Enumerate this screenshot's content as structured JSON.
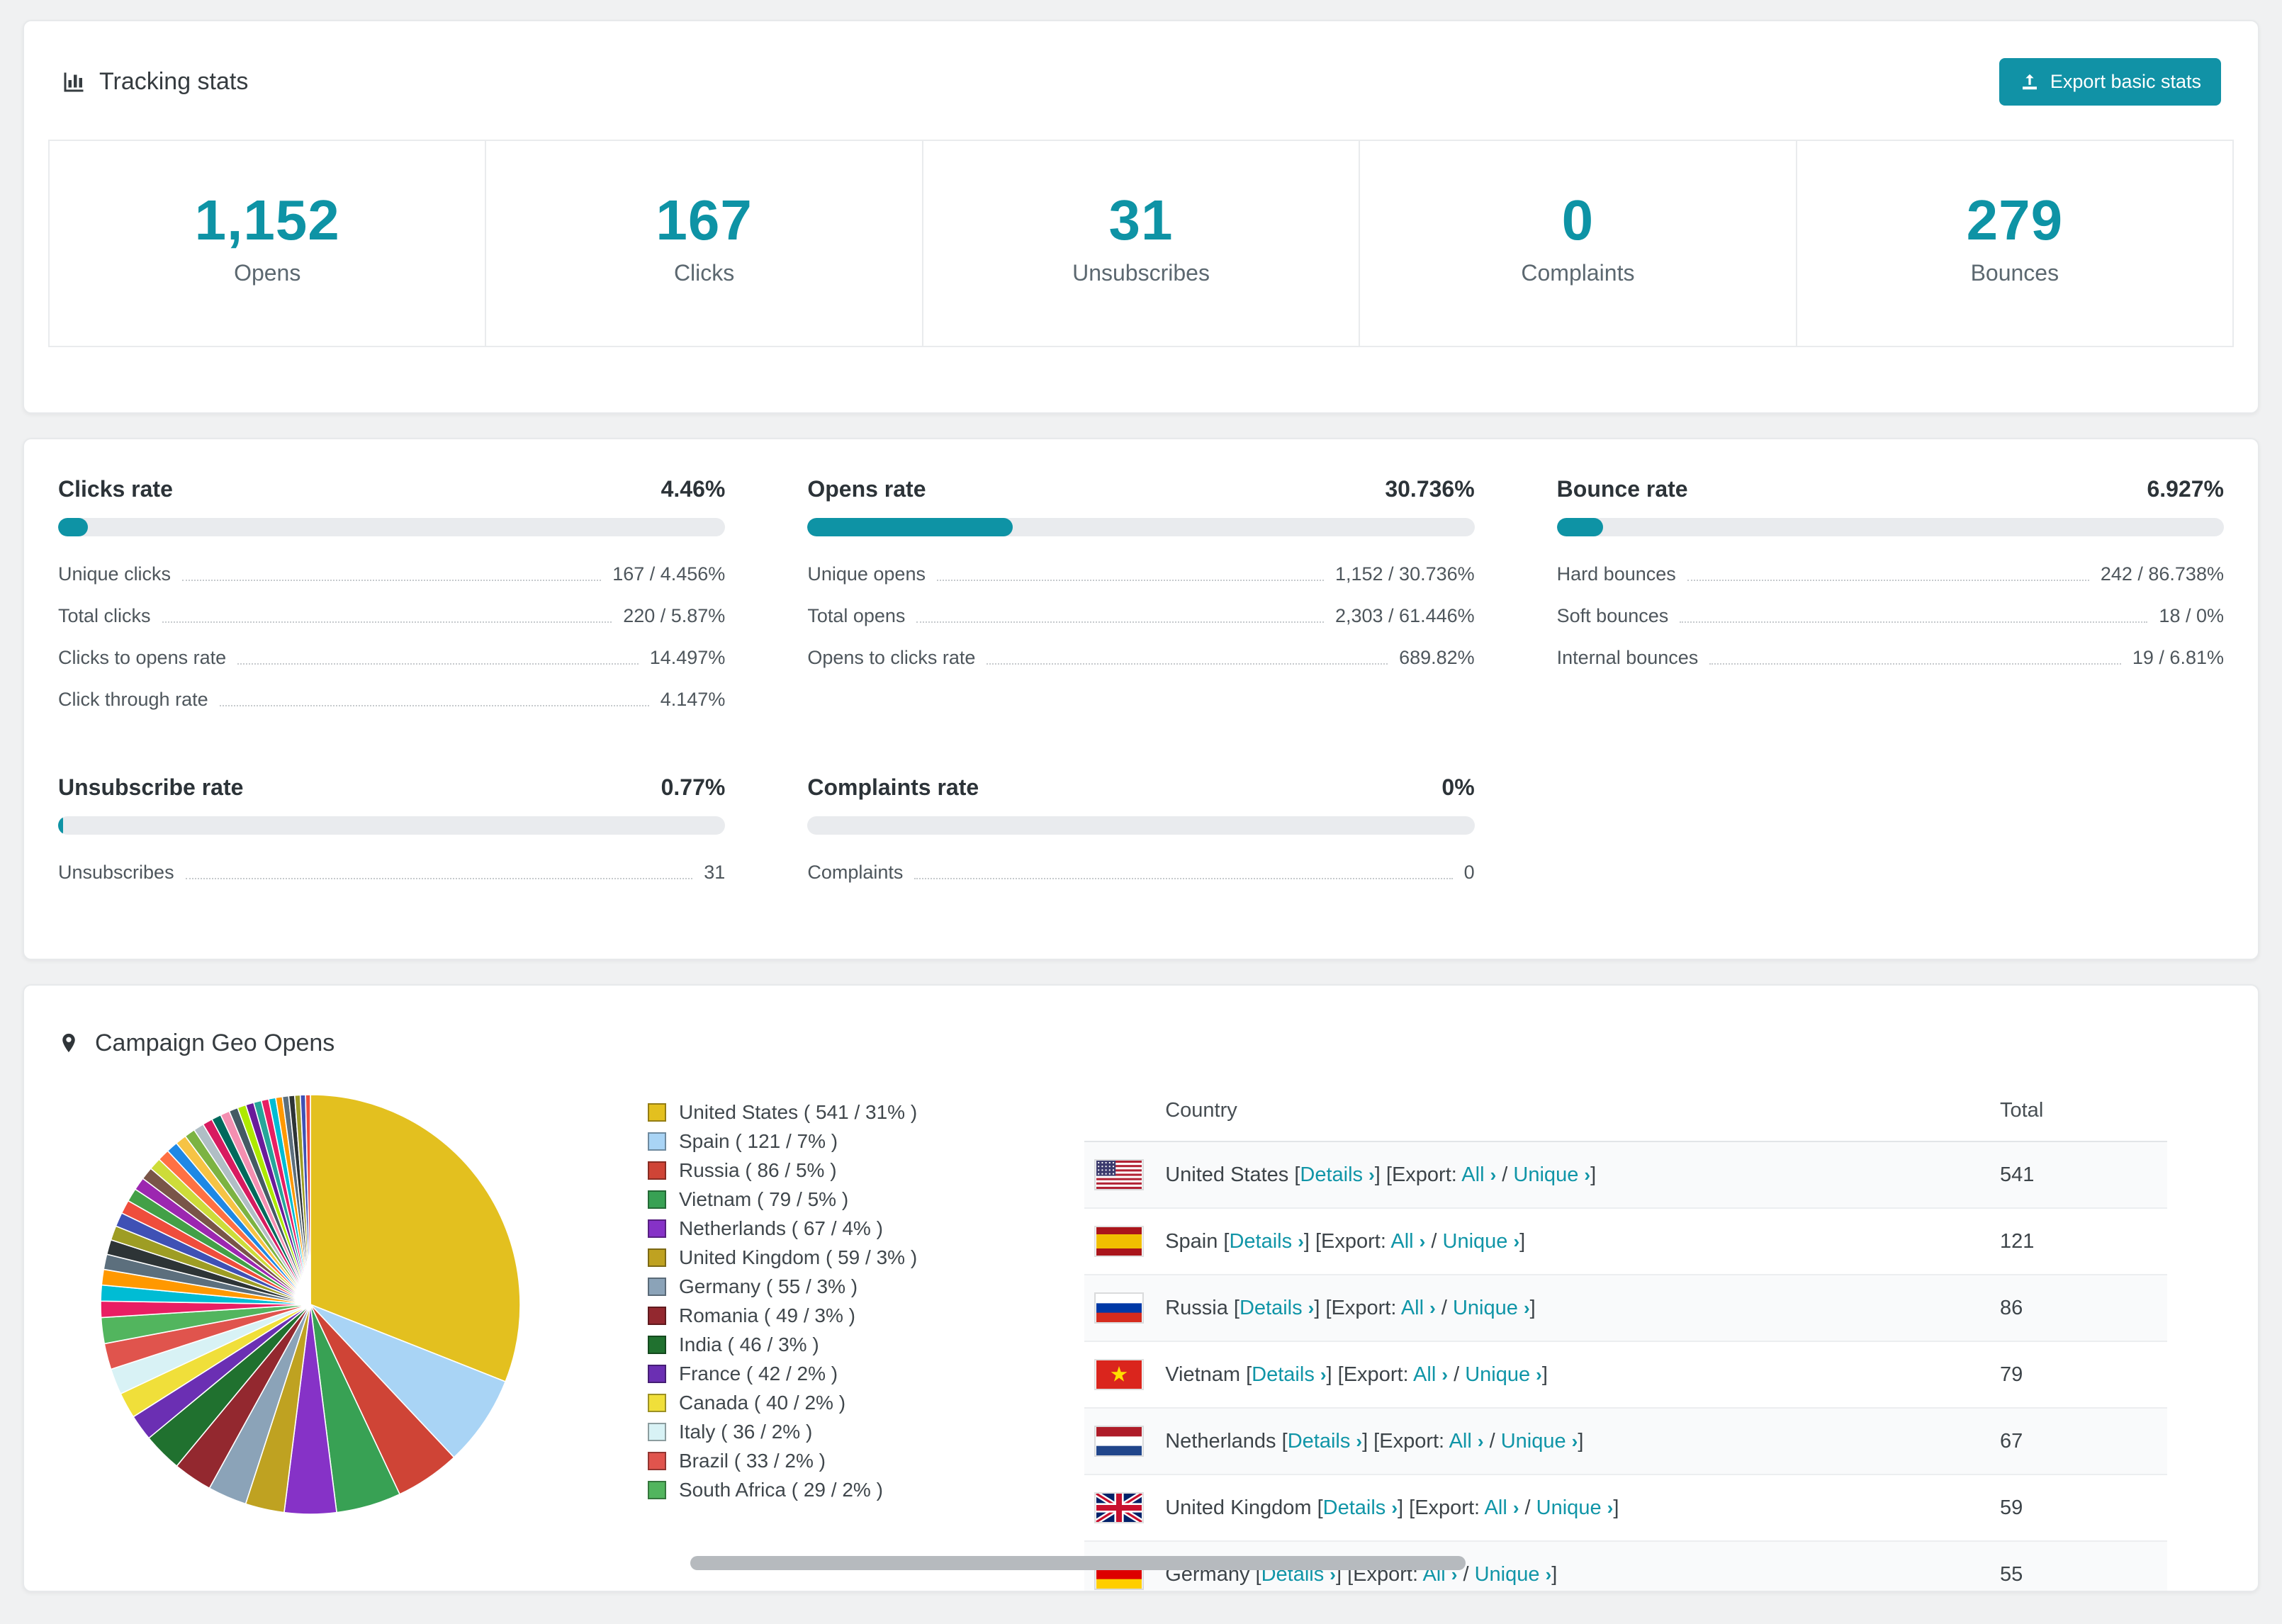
{
  "colors": {
    "accent": "#0e93a5",
    "bar_track": "#e9ebee"
  },
  "tracking": {
    "title": "Tracking stats",
    "export_button": "Export basic stats",
    "stats": [
      {
        "value": "1,152",
        "label": "Opens"
      },
      {
        "value": "167",
        "label": "Clicks"
      },
      {
        "value": "31",
        "label": "Unsubscribes"
      },
      {
        "value": "0",
        "label": "Complaints"
      },
      {
        "value": "279",
        "label": "Bounces"
      }
    ]
  },
  "rates": {
    "blocks": [
      {
        "title": "Clicks rate",
        "value": "4.46%",
        "percent": 4.46,
        "rows": [
          {
            "label": "Unique clicks",
            "value": "167 / 4.456%"
          },
          {
            "label": "Total clicks",
            "value": "220 / 5.87%"
          },
          {
            "label": "Clicks to opens rate",
            "value": "14.497%"
          },
          {
            "label": "Click through rate",
            "value": "4.147%"
          }
        ]
      },
      {
        "title": "Opens rate",
        "value": "30.736%",
        "percent": 30.736,
        "rows": [
          {
            "label": "Unique opens",
            "value": "1,152 / 30.736%"
          },
          {
            "label": "Total opens",
            "value": "2,303 / 61.446%"
          },
          {
            "label": "Opens to clicks rate",
            "value": "689.82%"
          }
        ]
      },
      {
        "title": "Bounce rate",
        "value": "6.927%",
        "percent": 6.927,
        "rows": [
          {
            "label": "Hard bounces",
            "value": "242 / 86.738%"
          },
          {
            "label": "Soft bounces",
            "value": "18 / 0%"
          },
          {
            "label": "Internal bounces",
            "value": "19 / 6.81%"
          }
        ]
      },
      {
        "title": "Unsubscribe rate",
        "value": "0.77%",
        "percent": 0.77,
        "rows": [
          {
            "label": "Unsubscribes",
            "value": "31"
          }
        ]
      },
      {
        "title": "Complaints rate",
        "value": "0%",
        "percent": 0,
        "rows": [
          {
            "label": "Complaints",
            "value": "0"
          }
        ]
      }
    ]
  },
  "geo": {
    "title": "Campaign Geo Opens",
    "table": {
      "country_header": "Country",
      "total_header": "Total",
      "details_label": "Details",
      "export_label": "Export:",
      "all_label": "All",
      "unique_label": "Unique",
      "chevron": "›",
      "separator": "/",
      "bracket_open": "[",
      "bracket_close": "]",
      "rows": [
        {
          "country": "United States",
          "flag": "us",
          "total": "541"
        },
        {
          "country": "Spain",
          "flag": "es",
          "total": "121"
        },
        {
          "country": "Russia",
          "flag": "ru",
          "total": "86"
        },
        {
          "country": "Vietnam",
          "flag": "vn",
          "total": "79"
        },
        {
          "country": "Netherlands",
          "flag": "nl",
          "total": "67"
        },
        {
          "country": "United Kingdom",
          "flag": "gb",
          "total": "59"
        },
        {
          "country": "Germany",
          "flag": "de",
          "total": "55"
        }
      ]
    }
  },
  "chart_data": {
    "type": "pie",
    "title": "Campaign Geo Opens",
    "legend_position": "right",
    "slices": [
      {
        "label": "United States",
        "count": 541,
        "percent": 31,
        "color": "#e3c01f"
      },
      {
        "label": "Spain",
        "count": 121,
        "percent": 7,
        "color": "#a9d4f5"
      },
      {
        "label": "Russia",
        "count": 86,
        "percent": 5,
        "color": "#cf4436"
      },
      {
        "label": "Vietnam",
        "count": 79,
        "percent": 5,
        "color": "#38a154"
      },
      {
        "label": "Netherlands",
        "count": 67,
        "percent": 4,
        "color": "#8632c7"
      },
      {
        "label": "United Kingdom",
        "count": 59,
        "percent": 3,
        "color": "#bfa221"
      },
      {
        "label": "Germany",
        "count": 55,
        "percent": 3,
        "color": "#8ba3b8"
      },
      {
        "label": "Romania",
        "count": 49,
        "percent": 3,
        "color": "#93282f"
      },
      {
        "label": "India",
        "count": 46,
        "percent": 3,
        "color": "#20712f"
      },
      {
        "label": "France",
        "count": 42,
        "percent": 2,
        "color": "#6b2fb3"
      },
      {
        "label": "Canada",
        "count": 40,
        "percent": 2,
        "color": "#f0df3a"
      },
      {
        "label": "Italy",
        "count": 36,
        "percent": 2,
        "color": "#d8f2f5"
      },
      {
        "label": "Brazil",
        "count": 33,
        "percent": 2,
        "color": "#e0544d"
      },
      {
        "label": "South Africa",
        "count": 29,
        "percent": 2,
        "color": "#52b55e"
      }
    ],
    "others": {
      "percent_total": 26,
      "slice_count": 32,
      "palette": [
        "#e91e63",
        "#00bcd4",
        "#ff9800",
        "#5c6f7d",
        "#2d3436",
        "#9e9d24",
        "#3f51b5",
        "#ef4d3c",
        "#43a047",
        "#9c27b0",
        "#795548",
        "#cddc39",
        "#ff7043",
        "#1e88e5",
        "#f6c344",
        "#7cb342",
        "#b0bec5",
        "#d81b60",
        "#00695c",
        "#f48fb1",
        "#455a64",
        "#aeea00",
        "#6a1b9a",
        "#26a69a"
      ]
    }
  }
}
